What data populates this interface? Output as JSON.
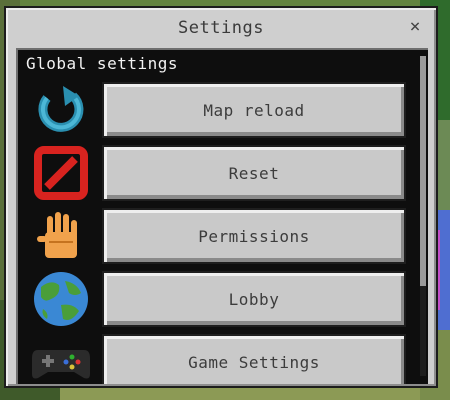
{
  "dialog": {
    "title": "Settings",
    "close_label": "×"
  },
  "panel": {
    "section_label": "Global settings",
    "items": [
      {
        "label": "Map reload",
        "icon": "reload-icon"
      },
      {
        "label": "Reset",
        "icon": "prohibited-icon"
      },
      {
        "label": "Permissions",
        "icon": "hand-icon"
      },
      {
        "label": "Lobby",
        "icon": "globe-icon"
      },
      {
        "label": "Game Settings",
        "icon": "controller-icon"
      }
    ]
  },
  "colors": {
    "button_face": "#c9c9c9",
    "panel_background": "#0e0e0e",
    "dialog_background": "#cfcfcf"
  }
}
